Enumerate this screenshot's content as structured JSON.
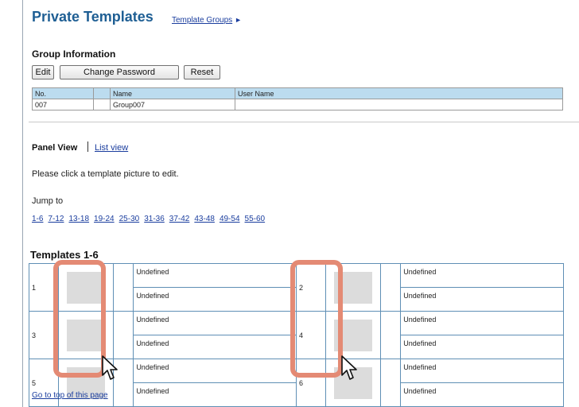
{
  "header": {
    "title": "Private Templates",
    "group_link": "Template Groups",
    "group_link_arrow": "►"
  },
  "group_info": {
    "heading": "Group Information",
    "buttons": {
      "edit": "Edit",
      "change_password": "Change Password",
      "reset": "Reset"
    },
    "columns": {
      "no": "No.",
      "blank": "",
      "name": "Name",
      "user": "User Name"
    },
    "row": {
      "no": "007",
      "blank": "",
      "name": "Group007",
      "user": ""
    }
  },
  "view": {
    "panel_view": "Panel View",
    "list_view": "List view"
  },
  "instruction": "Please click a template picture to edit.",
  "jump": {
    "label": "Jump to",
    "links": [
      "1-6",
      "7-12",
      "13-18",
      "19-24",
      "25-30",
      "31-36",
      "37-42",
      "43-48",
      "49-54",
      "55-60"
    ]
  },
  "templates": {
    "heading": "Templates 1-6",
    "items": [
      {
        "no": "1",
        "line1": "Undefined",
        "line2": "Undefined"
      },
      {
        "no": "2",
        "line1": "Undefined",
        "line2": "Undefined"
      },
      {
        "no": "3",
        "line1": "Undefined",
        "line2": "Undefined"
      },
      {
        "no": "4",
        "line1": "Undefined",
        "line2": "Undefined"
      },
      {
        "no": "5",
        "line1": "Undefined",
        "line2": "Undefined"
      },
      {
        "no": "6",
        "line1": "Undefined",
        "line2": "Undefined"
      }
    ]
  },
  "footer": {
    "go_top": "Go to top of this page"
  },
  "colors": {
    "title": "#1f5f94",
    "link": "#1a3d9e",
    "header_cell": "#bcdcef",
    "highlight": "#e48a74"
  }
}
